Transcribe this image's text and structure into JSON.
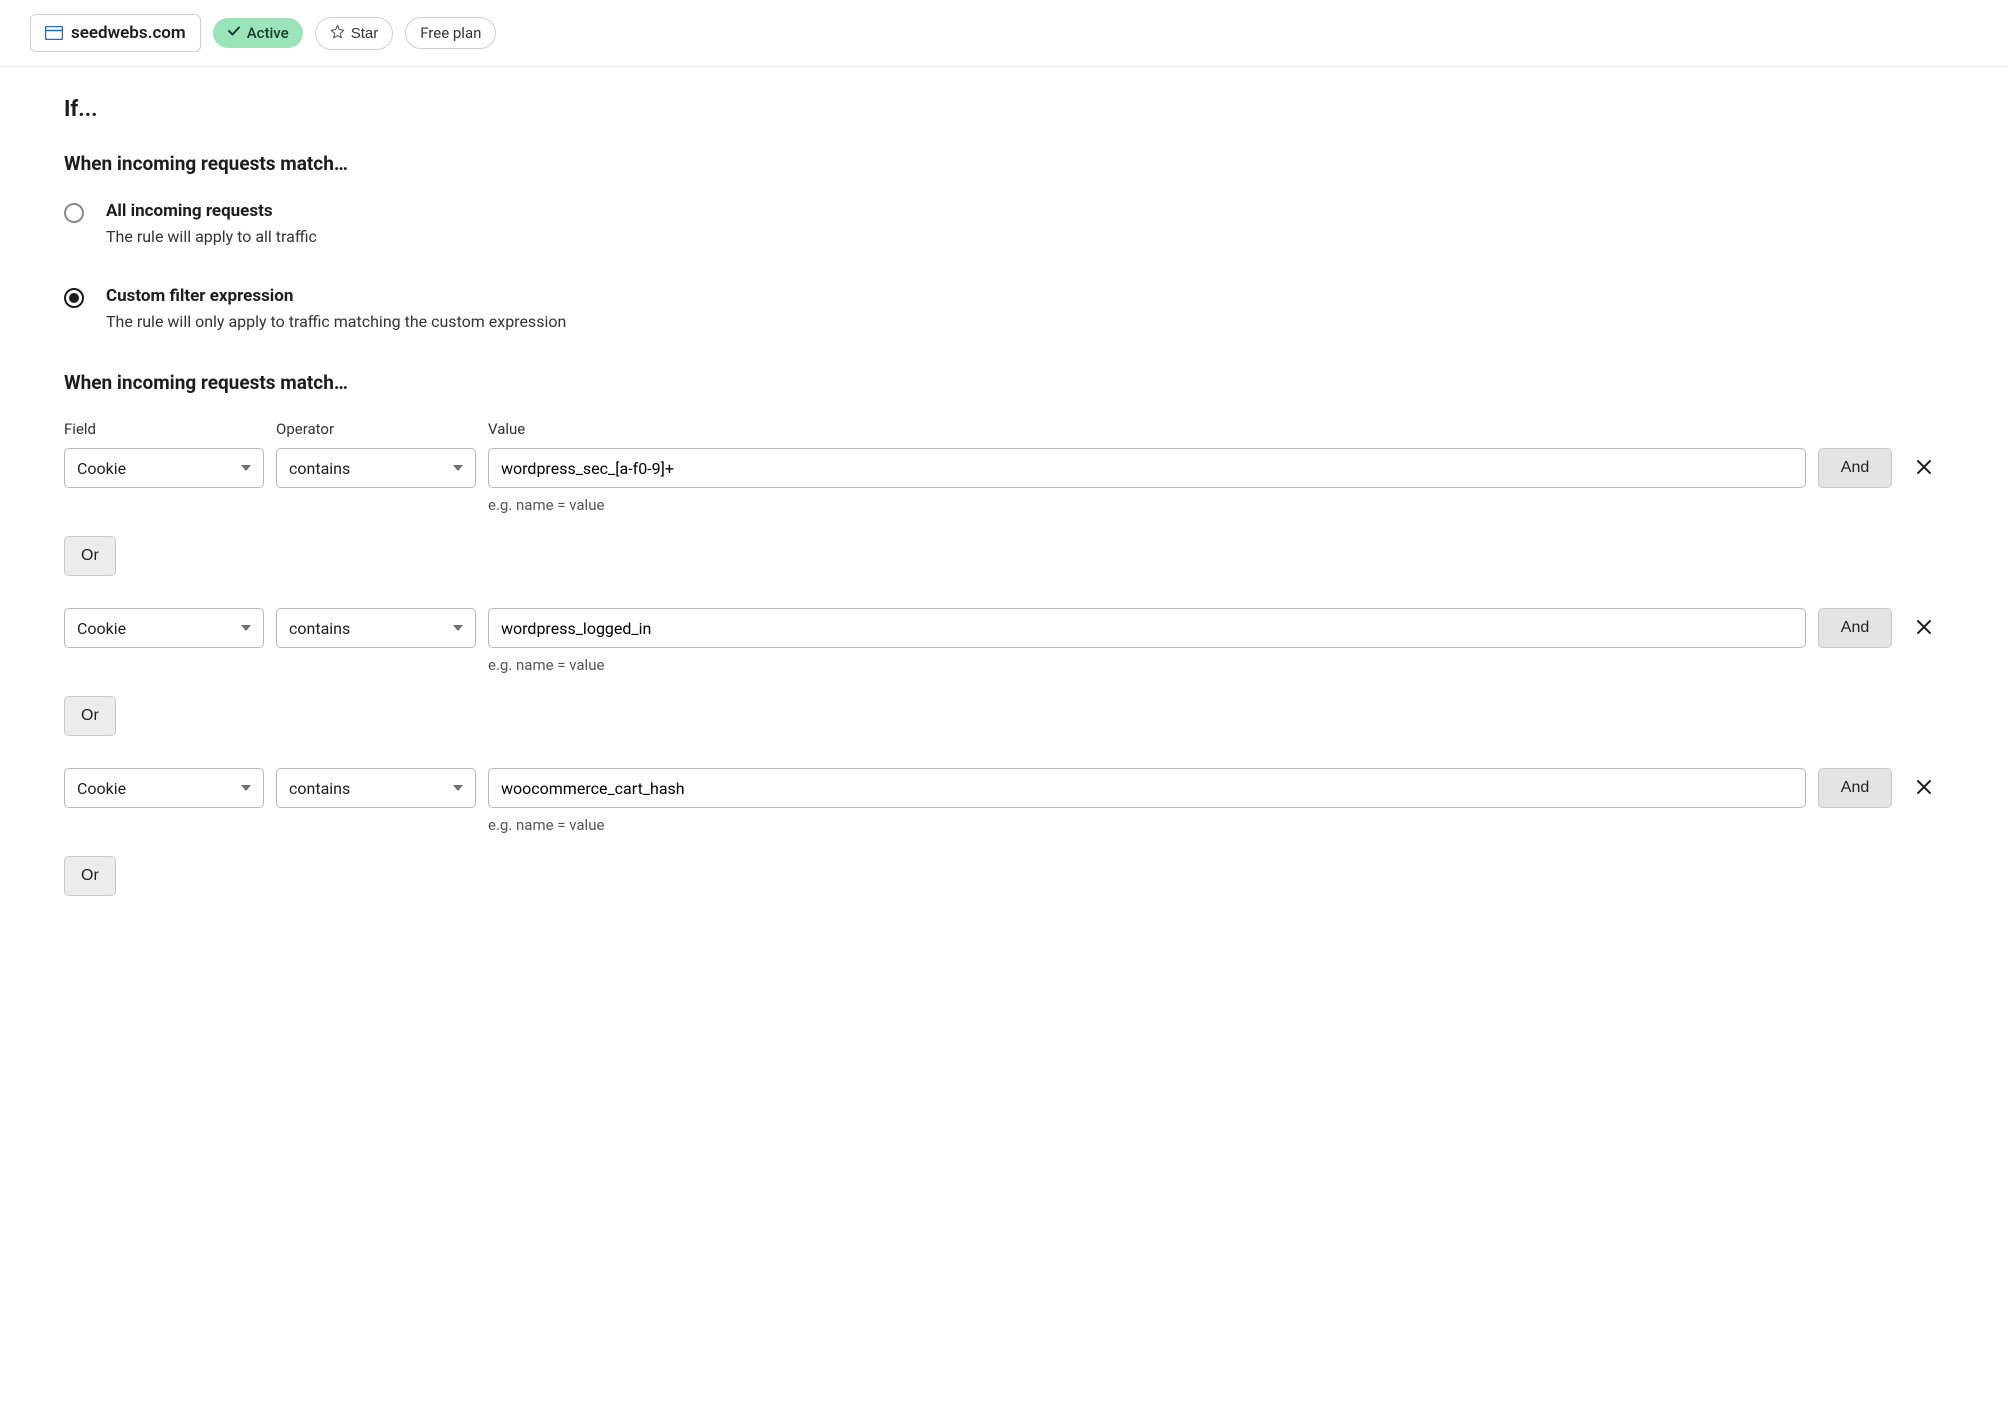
{
  "header": {
    "site_name": "seedwebs.com",
    "status_label": "Active",
    "star_label": "Star",
    "plan_label": "Free plan"
  },
  "section": {
    "if_heading": "If...",
    "match_heading": "When incoming requests match…",
    "match_heading2": "When incoming requests match…"
  },
  "radios": {
    "all": {
      "title": "All incoming requests",
      "desc": "The rule will apply to all traffic",
      "selected": false
    },
    "custom": {
      "title": "Custom filter expression",
      "desc": "The rule will only apply to traffic matching the custom expression",
      "selected": true
    }
  },
  "columns": {
    "field": "Field",
    "operator": "Operator",
    "value": "Value"
  },
  "buttons": {
    "and": "And",
    "or": "Or"
  },
  "hint": "e.g. name = value",
  "rules": [
    {
      "field": "Cookie",
      "operator": "contains",
      "value": "wordpress_sec_[a-f0-9]+"
    },
    {
      "field": "Cookie",
      "operator": "contains",
      "value": "wordpress_logged_in"
    },
    {
      "field": "Cookie",
      "operator": "contains",
      "value": "woocommerce_cart_hash"
    }
  ]
}
